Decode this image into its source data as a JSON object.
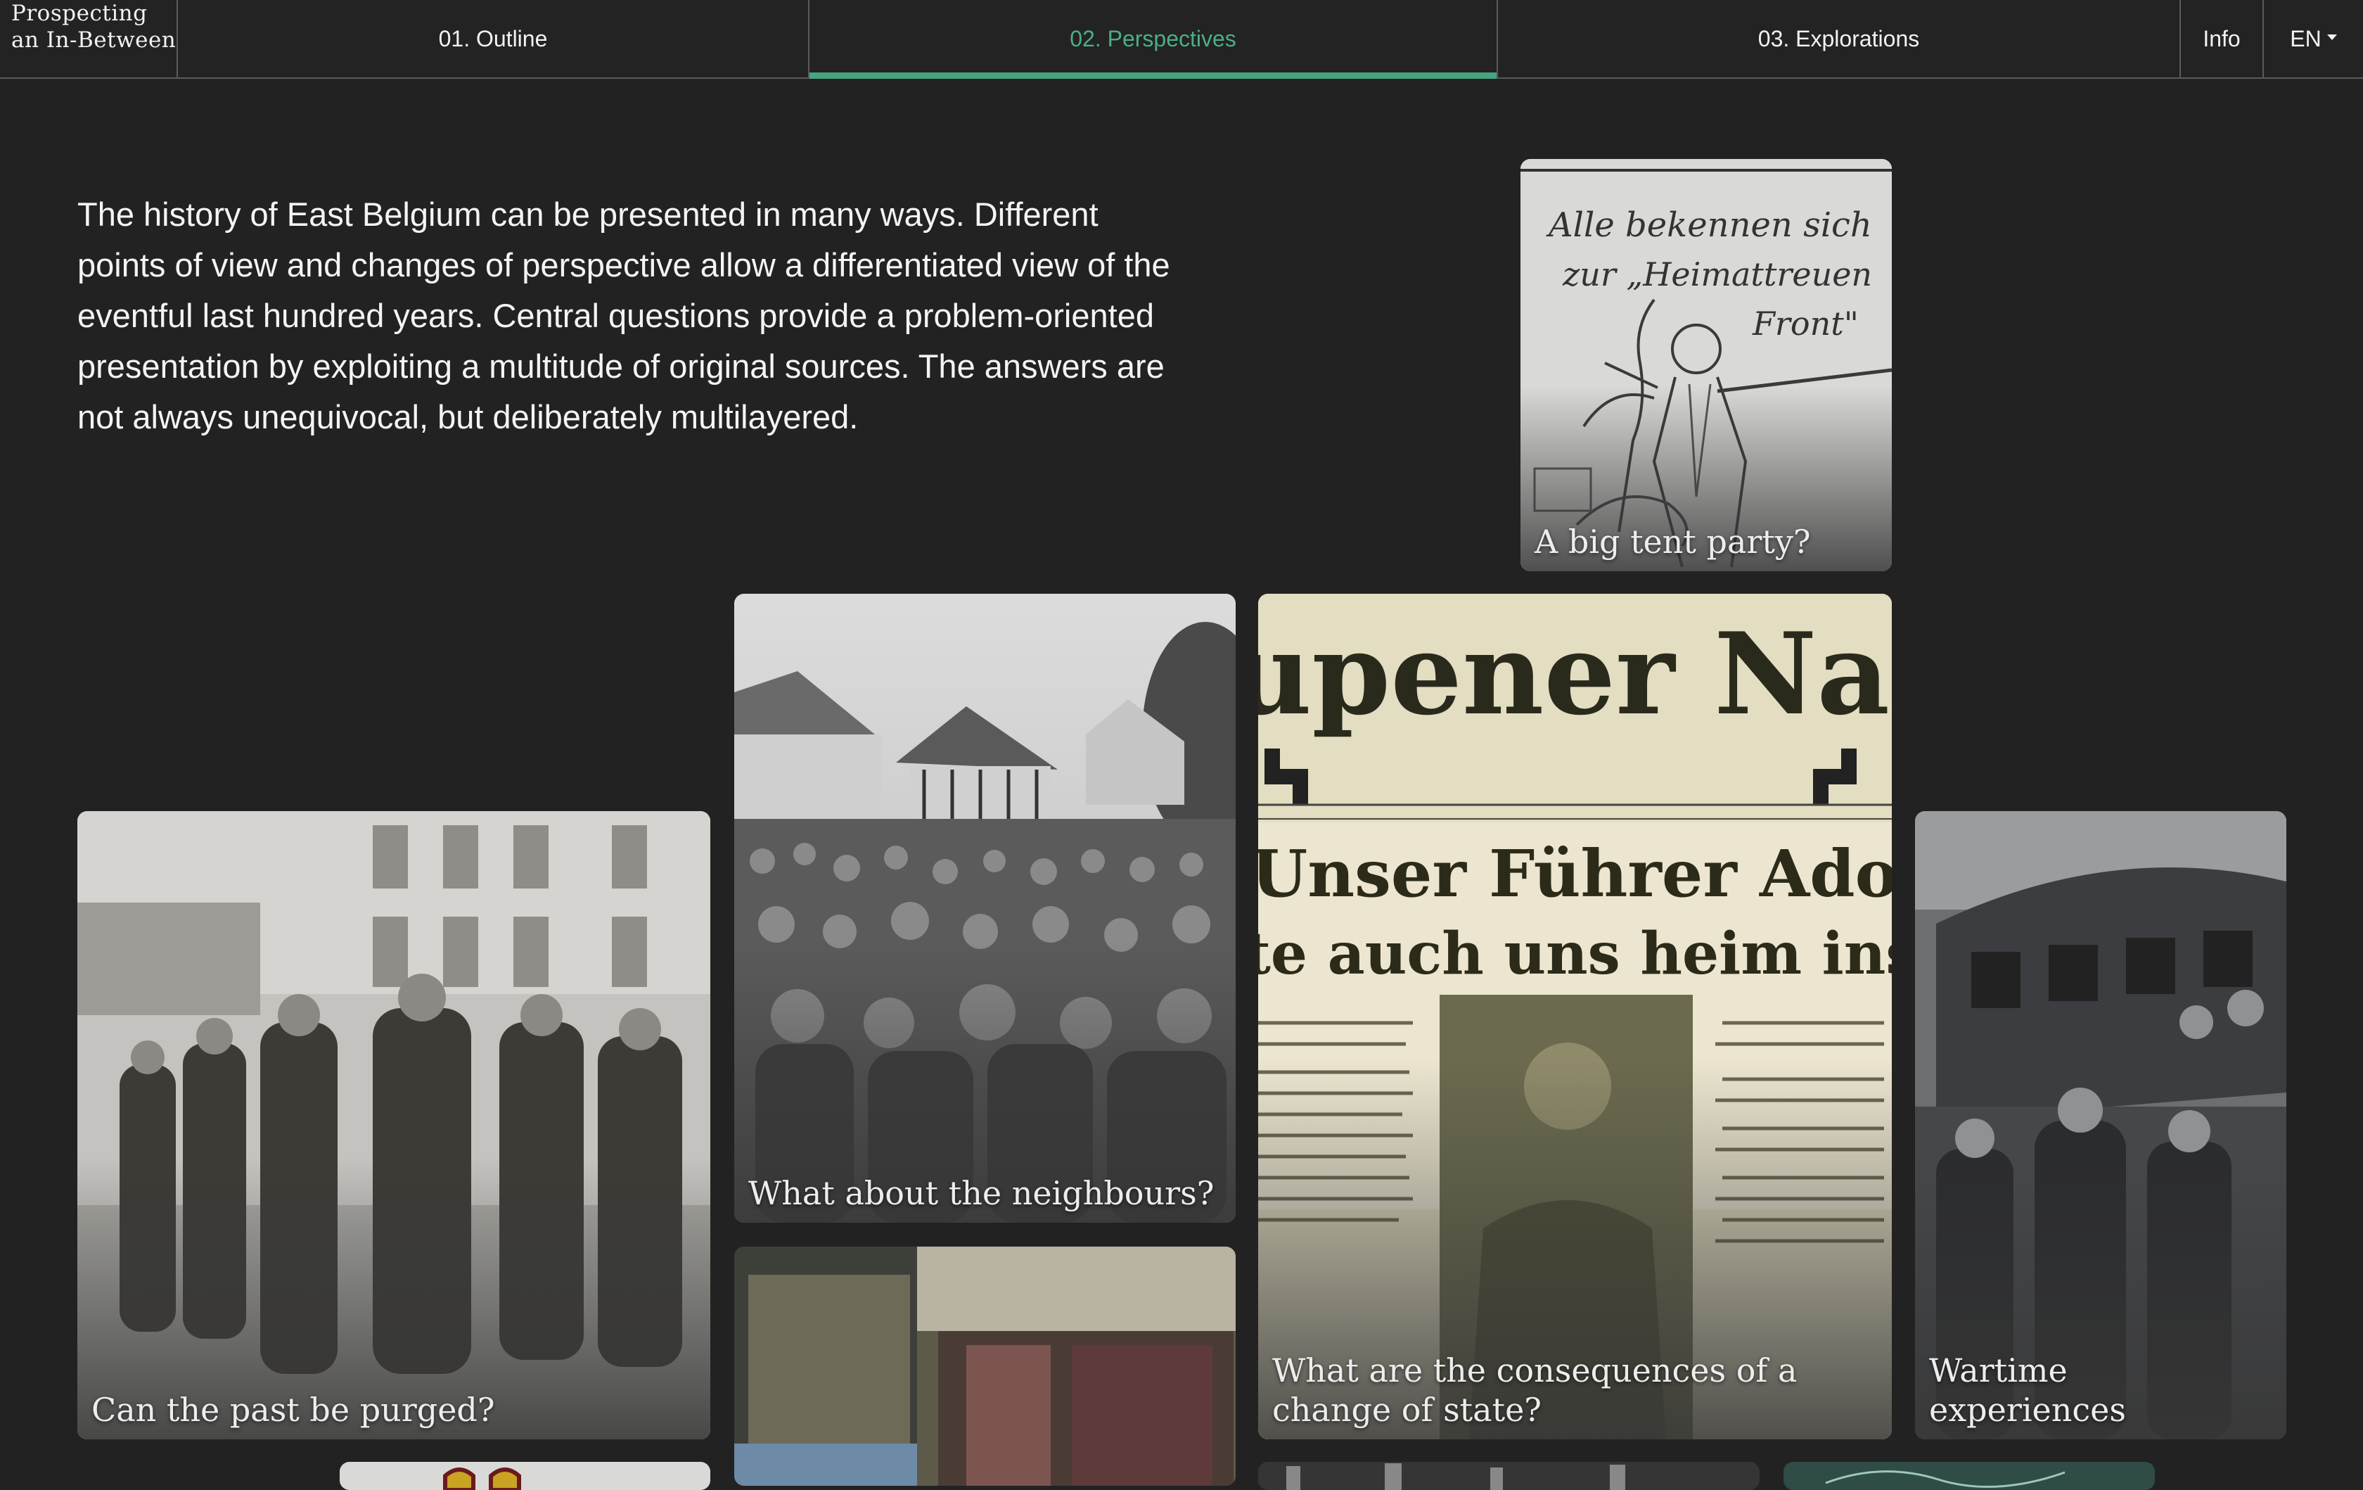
{
  "nav": {
    "brand_line1": "Prospecting",
    "brand_line2": "an In-Between",
    "tabs": [
      {
        "label": "01. Outline"
      },
      {
        "label": "02. Perspectives",
        "active": true
      },
      {
        "label": "03. Explorations"
      }
    ],
    "info_label": "Info",
    "language": "EN"
  },
  "intro": {
    "text": "The history of East Belgium can be presented in many ways. Different points of view and changes of perspective allow a differentiated view of the eventful last hundred years. Central questions provide a problem-oriented presentation by exploiting a multitude of original sources. The answers are not always unequivocal, but deliberately multilayered."
  },
  "cards": [
    {
      "caption": "A big tent party?",
      "cartoon_text": "Alle bekennen sich zur „Heimattreuen Front“"
    },
    {
      "caption": "What about the neighbours?"
    },
    {
      "caption": "What are the consequences of a change of state?",
      "masthead": "upener Nachrichte",
      "headline1": "Unser Führer Adolf Hitle",
      "headline2": "te auch uns heim ins Re"
    },
    {
      "caption": "Can the past be purged?"
    },
    {
      "caption": "Wartime experiences"
    }
  ],
  "theme": {
    "accent": "#46a47f",
    "background": "#222222"
  }
}
